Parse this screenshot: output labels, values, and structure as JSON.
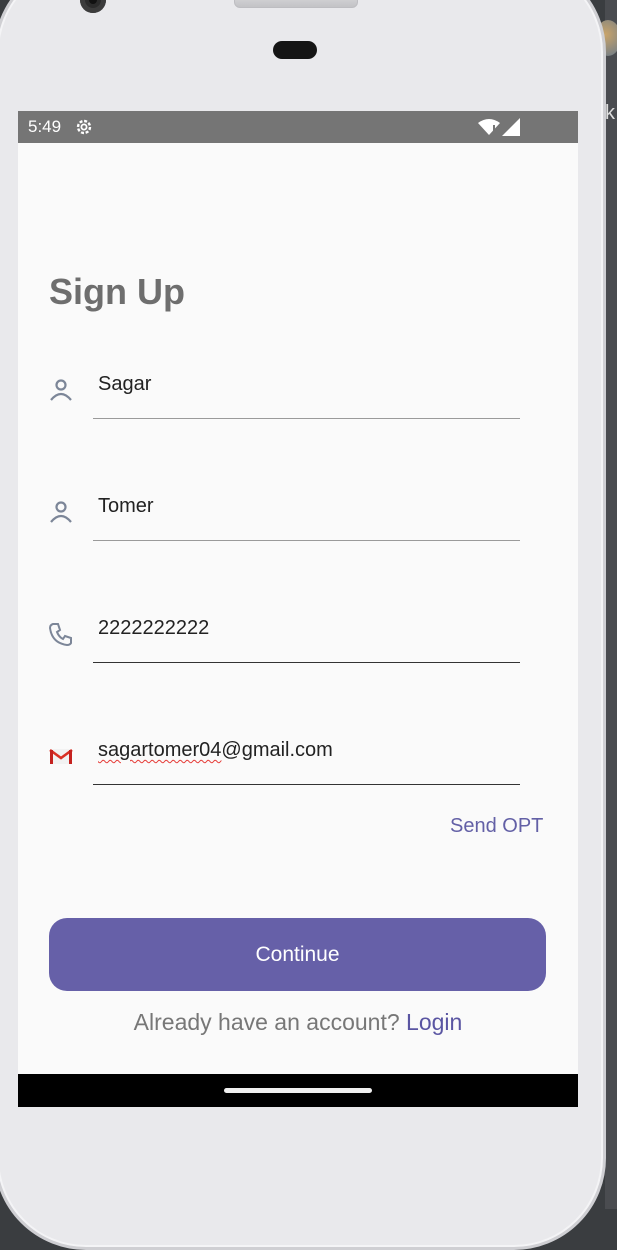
{
  "status_bar": {
    "time": "5:49"
  },
  "form": {
    "title": "Sign Up",
    "fields": [
      {
        "icon": "person-icon",
        "value": "Sagar"
      },
      {
        "icon": "person-icon",
        "value": "Tomer"
      },
      {
        "icon": "phone-icon",
        "value": "2222222222"
      },
      {
        "icon": "gmail-icon",
        "value_flagged": "sagartomer04",
        "value_rest": "@gmail.com"
      }
    ],
    "send_otp_label": "Send OPT",
    "continue_label": "Continue",
    "login_prompt": "Already have an account?",
    "login_link": "Login"
  },
  "colors": {
    "accent": "#6660a8",
    "status_bar": "#757575",
    "title": "#6e6e6e"
  }
}
